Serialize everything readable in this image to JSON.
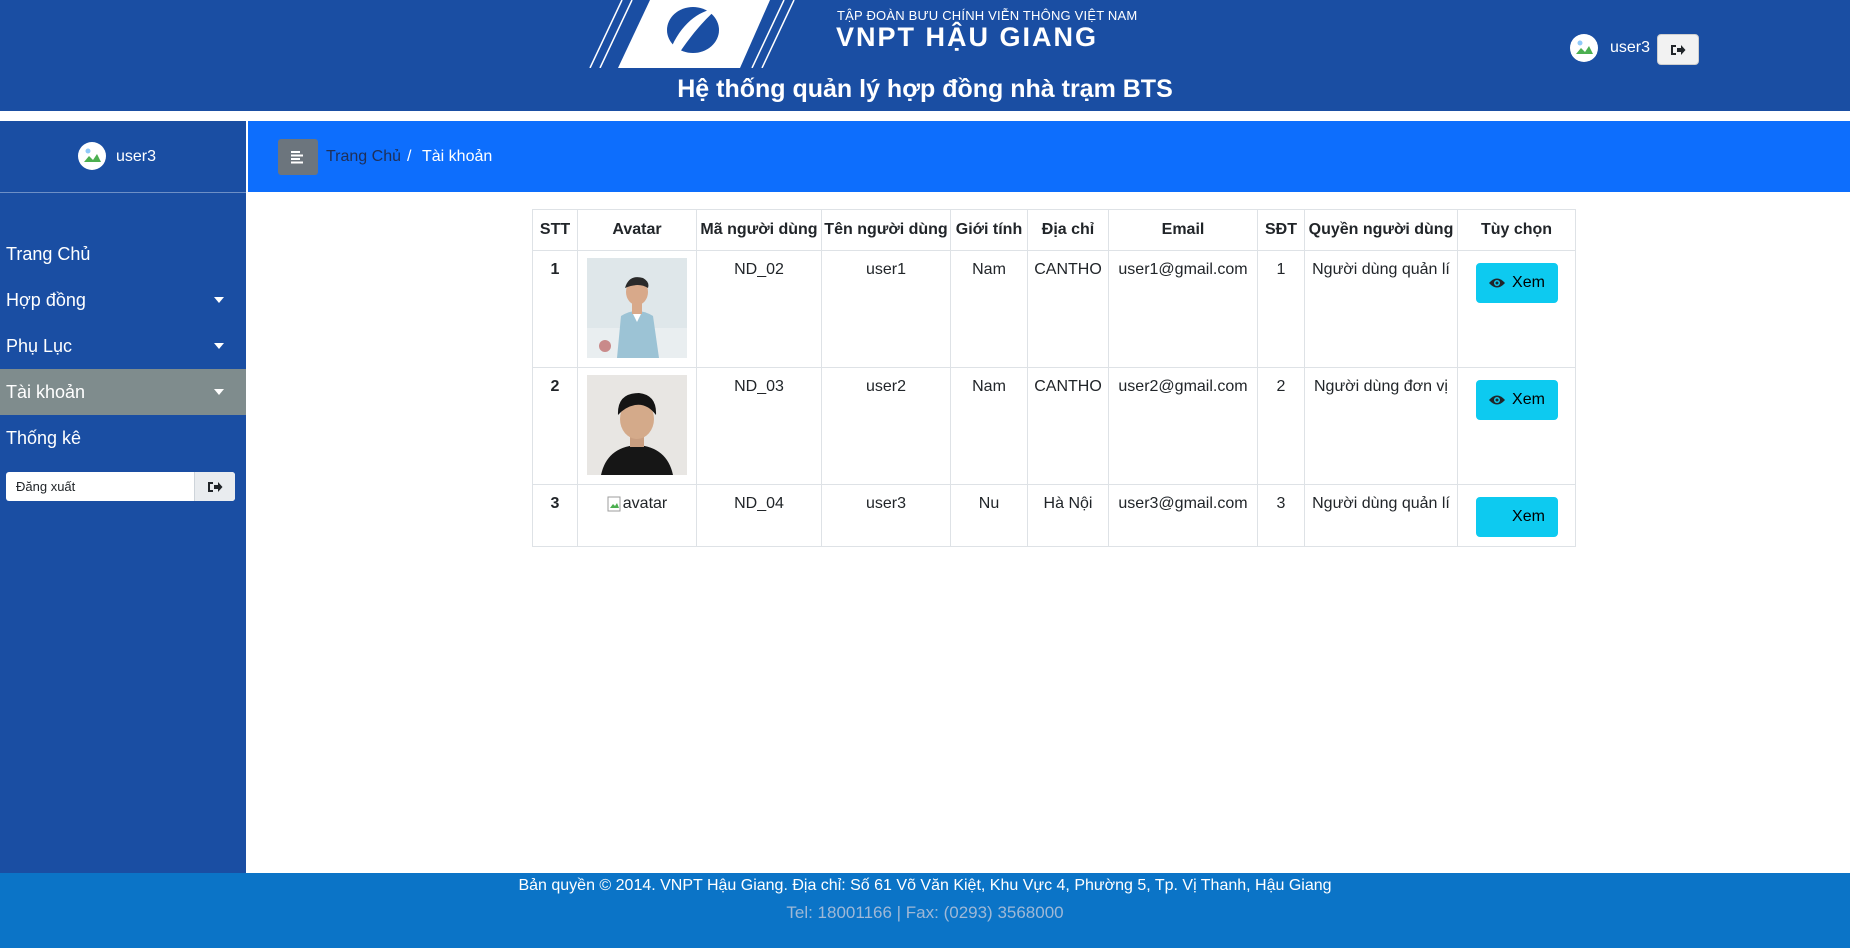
{
  "header": {
    "brand_top": "TẬP ĐOÀN BƯU CHÍNH VIỄN THÔNG VIỆT NAM",
    "brand_main": "VNPT HẬU GIANG",
    "system_title": "Hệ thống quản lý hợp đồng nhà trạm BTS",
    "username": "user3",
    "logout_icon": "sign-out-icon"
  },
  "sidebar": {
    "username": "user3",
    "items": [
      {
        "label": "Trang Chủ",
        "has_caret": false,
        "active": false
      },
      {
        "label": "Hợp đồng",
        "has_caret": true,
        "active": false
      },
      {
        "label": "Phụ Lục",
        "has_caret": true,
        "active": false
      },
      {
        "label": "Tài khoản",
        "has_caret": true,
        "active": true
      },
      {
        "label": "Thống kê",
        "has_caret": false,
        "active": false
      }
    ],
    "logout_label": "Đăng xuất"
  },
  "breadcrumb": {
    "home": "Trang Chủ",
    "separator": "/",
    "current": "Tài khoản"
  },
  "table": {
    "headers": [
      "STT",
      "Avatar",
      "Mã người dùng",
      "Tên người dùng",
      "Giới tính",
      "Địa chỉ",
      "Email",
      "SĐT",
      "Quyền người dùng",
      "Tùy chọn"
    ],
    "rows": [
      {
        "stt": "1",
        "avatar": "photo",
        "code": "ND_02",
        "name": "user1",
        "gender": "Nam",
        "address": "CANTHO",
        "email": "user1@gmail.com",
        "phone": "1",
        "role": "Người dùng quản lí",
        "action": "Xem"
      },
      {
        "stt": "2",
        "avatar": "photo",
        "code": "ND_03",
        "name": "user2",
        "gender": "Nam",
        "address": "CANTHO",
        "email": "user2@gmail.com",
        "phone": "2",
        "role": "Người dùng đơn vị",
        "action": "Xem"
      },
      {
        "stt": "3",
        "avatar": "broken",
        "avatar_alt": "avatar",
        "code": "ND_04",
        "name": "user3",
        "gender": "Nu",
        "address": "Hà Nội",
        "email": "user3@gmail.com",
        "phone": "3",
        "role": "Người dùng quản lí",
        "action": "Xem"
      }
    ]
  },
  "footer": {
    "line1": "Bản quyền © 2014. VNPT Hậu Giang. Địa chỉ: Số 61 Võ Văn Kiệt, Khu Vực 4, Phường 5, Tp. Vị Thanh, Hậu Giang",
    "line2": "Tel: 18001166 | Fax: (0293) 3568000"
  },
  "colors": {
    "header_bg": "#1a4ea3",
    "breadcrumb_bg": "#0d6efd",
    "active_menu_bg": "#7f8c8d",
    "button_info": "#0dcaf0",
    "footer_bg": "#0b74c7"
  }
}
